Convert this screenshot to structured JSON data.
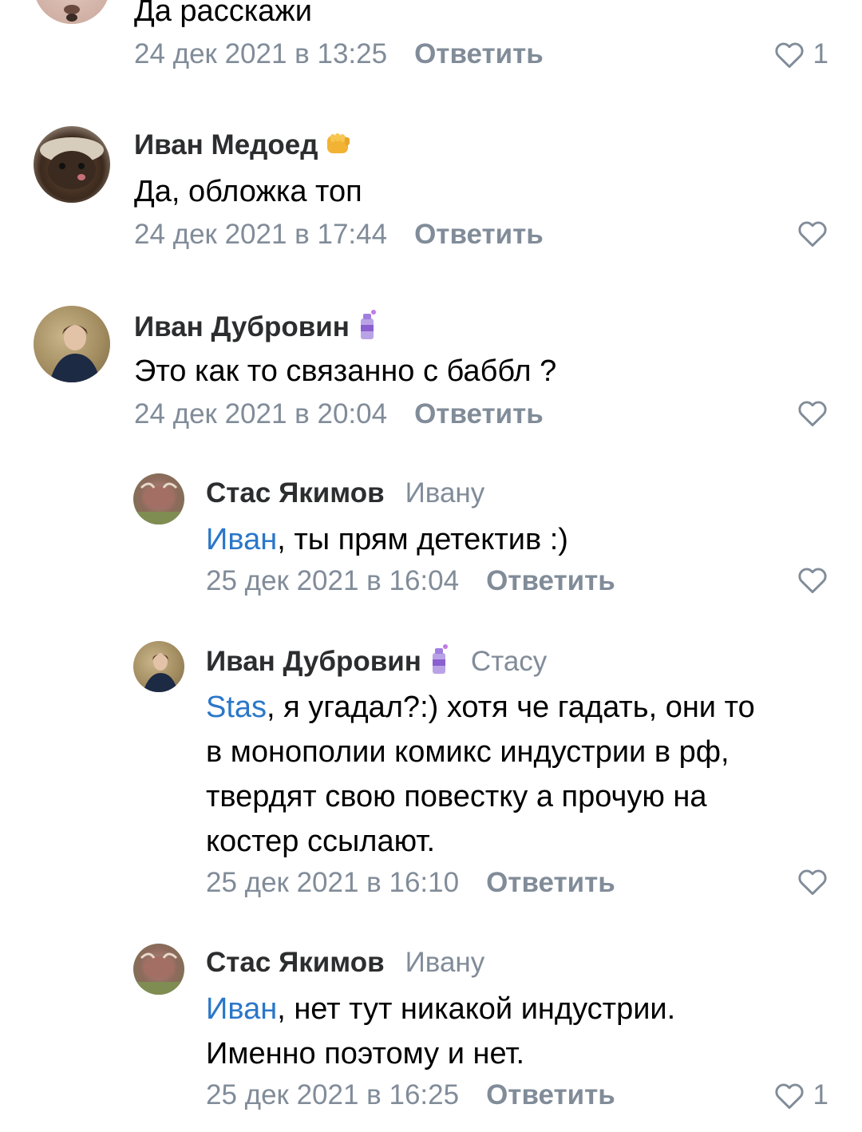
{
  "comments": [
    {
      "author": "",
      "text": "Да расскажи",
      "date": "24 дек 2021 в 13:25",
      "reply_label": "Ответить",
      "likes": "1"
    },
    {
      "author": "Иван Медоед",
      "badge": "fist-emoji",
      "text": "Да, обложка топ",
      "date": "24 дек 2021 в 17:44",
      "reply_label": "Ответить"
    },
    {
      "author": "Иван Дубровин",
      "badge": "spray-can-emoji",
      "text": "Это как то связанно с баббл ?",
      "date": "24 дек 2021 в 20:04",
      "reply_label": "Ответить"
    },
    {
      "author": "Стас Якимов",
      "reply_to": "Ивану",
      "mention": "Иван",
      "text": ", ты прям детектив :)",
      "date": "25 дек 2021 в 16:04",
      "reply_label": "Ответить"
    },
    {
      "author": "Иван Дубровин",
      "badge": "spray-can-emoji",
      "reply_to": "Стасу",
      "mention": "Stas",
      "text_line1": ", я угадал?:) хотя че гадать, они то",
      "text_line2": "в монополии комикс индустрии в рф,",
      "text_line3": "твердят свою повестку а прочую на",
      "text_line4": "костер ссылают.",
      "date": "25 дек 2021 в 16:10",
      "reply_label": "Ответить"
    },
    {
      "author": "Стас Якимов",
      "reply_to": "Ивану",
      "mention": "Иван",
      "text_line1": ", нет тут никакой индустрии.",
      "text_line2": "Именно поэтому и нет.",
      "date": "25 дек 2021 в 16:25",
      "reply_label": "Ответить",
      "likes": "1"
    }
  ],
  "colors": {
    "secondary_text": "#818c99",
    "mention": "#2a77c9",
    "author": "#2c2d2e"
  },
  "icons": [
    "heart-outline-icon",
    "fist-emoji",
    "spray-can-emoji"
  ]
}
